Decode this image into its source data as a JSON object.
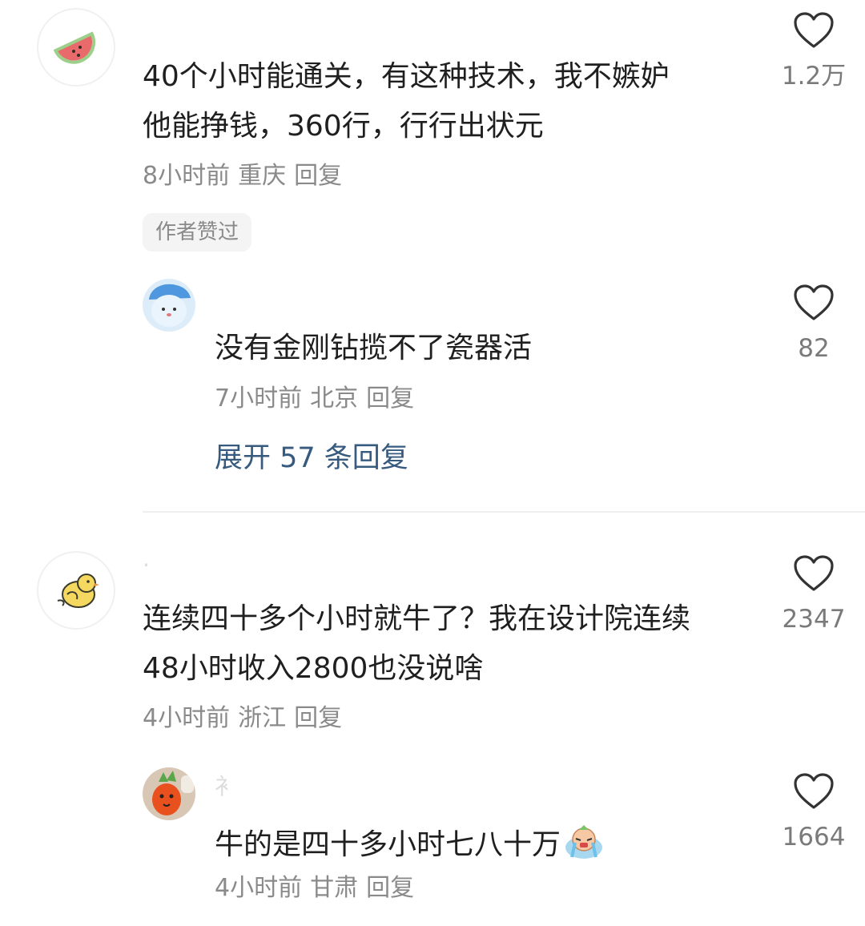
{
  "comments": [
    {
      "text_lines": [
        "40个小时能通关，有这种技术，我不嫉妒",
        "他能挣钱，360行，行行出状元"
      ],
      "time": "8小时前",
      "location": "重庆",
      "reply_label": "回复",
      "likes": "1.2万",
      "author_liked_tag": "作者赞过",
      "avatar_icon": "watermelon-icon"
    },
    {
      "text_lines": [
        "没有金刚钻揽不了瓷器活"
      ],
      "time": "7小时前",
      "location": "北京",
      "reply_label": "回复",
      "likes": "82",
      "avatar_icon": "blue-blob-cap-icon"
    },
    {
      "text_lines": [
        "连续四十多个小时就牛了？我在设计院连续",
        "48小时收入2800也没说啥"
      ],
      "time": "4小时前",
      "location": "浙江",
      "reply_label": "回复",
      "likes": "2347",
      "avatar_icon": "yellow-chick-icon"
    },
    {
      "text_lines": [
        "牛的是四十多小时七八十万"
      ],
      "time": "4小时前",
      "location": "甘肃",
      "reply_label": "回复",
      "likes": "1664",
      "avatar_icon": "carrot-plush-icon"
    }
  ],
  "expand_replies": "展开 57 条回复",
  "faint_name_glyph": "衤",
  "colors": {
    "text": "#1f1f1f",
    "meta": "#8a8a8a",
    "expand_link": "#375a7f",
    "divider": "#efefef"
  }
}
